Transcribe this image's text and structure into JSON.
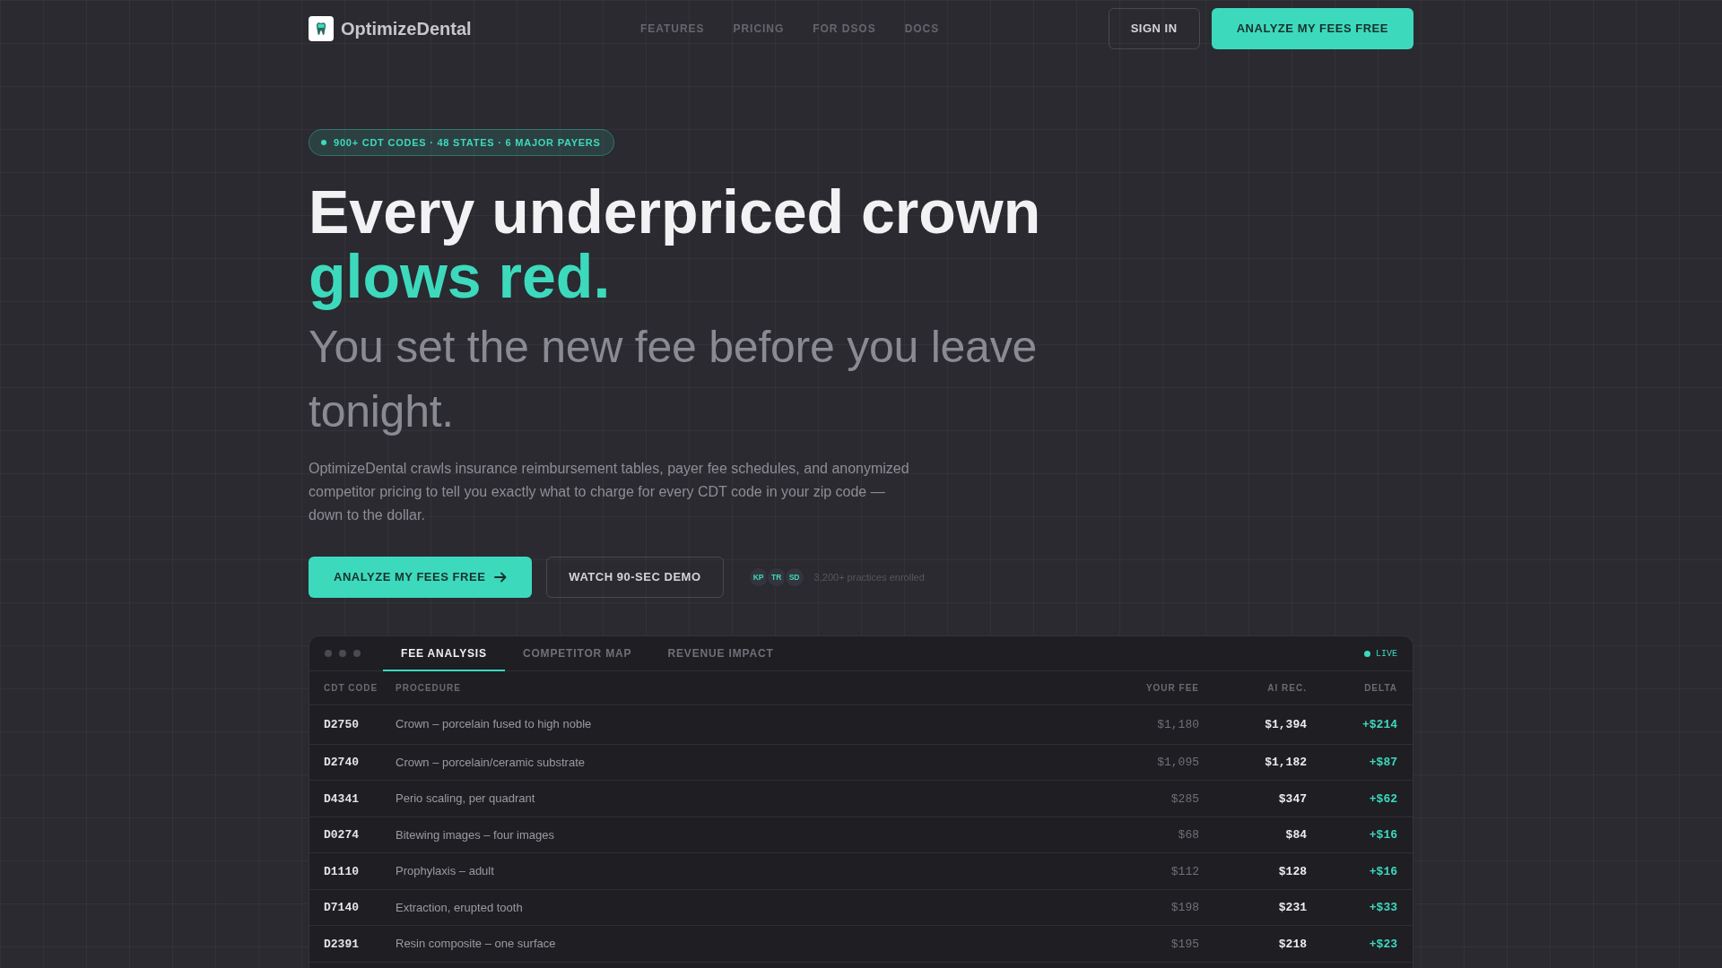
{
  "nav": {
    "brand": "OptimizeDental",
    "links": [
      "FEATURES",
      "PRICING",
      "FOR DSOS",
      "DOCS"
    ],
    "sign_in": "SIGN IN",
    "cta": "ANALYZE MY FEES FREE"
  },
  "hero": {
    "badge": "900+ CDT CODES · 48 STATES · 6 MAJOR PAYERS",
    "headline": "Every underpriced crown",
    "headline_accent": "glows red.",
    "subheadline": "You set the new fee before you leave tonight.",
    "description": "OptimizeDental crawls insurance reimbursement tables, payer fee schedules, and anonymized competitor pricing to tell you exactly what to charge for every CDT code in your zip code — down to the dollar.",
    "primary_button": "ANALYZE MY FEES FREE",
    "secondary_button": "WATCH 90-SEC DEMO",
    "avatars": [
      "KP",
      "TR",
      "SD"
    ],
    "social_proof": "3,200+ practices enrolled"
  },
  "panel": {
    "tabs": [
      {
        "label": "FEE ANALYSIS",
        "selected": true
      },
      {
        "label": "COMPETITOR MAP",
        "selected": false
      },
      {
        "label": "REVENUE IMPACT",
        "selected": false
      }
    ],
    "status": "LIVE",
    "table": {
      "columns": [
        "CDT CODE",
        "PROCEDURE",
        "YOUR FEE",
        "AI REC.",
        "DELTA"
      ],
      "rows": [
        {
          "code": "D2750",
          "procedure": "Crown – porcelain fused to high noble",
          "your_fee": "$1,180",
          "ai_rec": "$1,394",
          "delta": "+$214"
        },
        {
          "code": "D2740",
          "procedure": "Crown – porcelain/ceramic substrate",
          "your_fee": "$1,095",
          "ai_rec": "$1,182",
          "delta": "+$87"
        },
        {
          "code": "D4341",
          "procedure": "Perio scaling, per quadrant",
          "your_fee": "$285",
          "ai_rec": "$347",
          "delta": "+$62"
        },
        {
          "code": "D0274",
          "procedure": "Bitewing images – four images",
          "your_fee": "$68",
          "ai_rec": "$84",
          "delta": "+$16"
        },
        {
          "code": "D1110",
          "procedure": "Prophylaxis – adult",
          "your_fee": "$112",
          "ai_rec": "$128",
          "delta": "+$16"
        },
        {
          "code": "D7140",
          "procedure": "Extraction, erupted tooth",
          "your_fee": "$198",
          "ai_rec": "$231",
          "delta": "+$33"
        },
        {
          "code": "D2391",
          "procedure": "Resin composite – one surface",
          "your_fee": "$195",
          "ai_rec": "$218",
          "delta": "+$23"
        }
      ]
    }
  }
}
